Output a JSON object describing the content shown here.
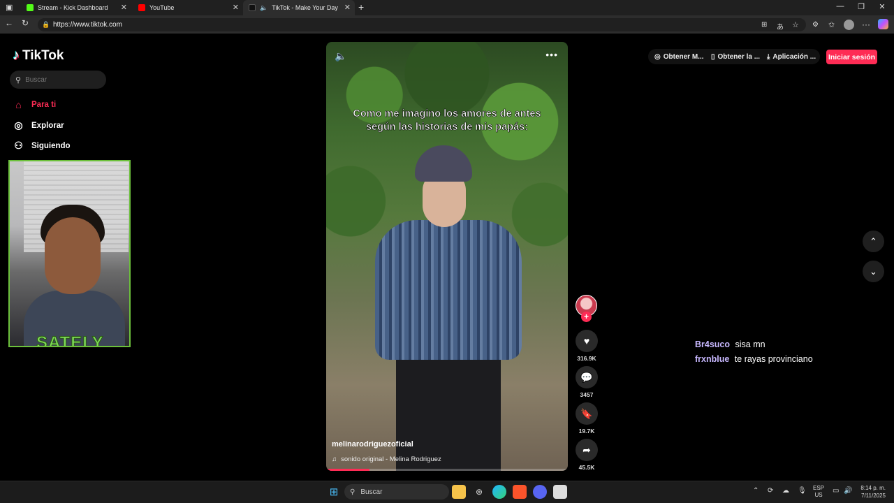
{
  "browser": {
    "tabs": [
      {
        "title": "Stream - Kick Dashboard",
        "favicon_color": "#53fc18"
      },
      {
        "title": "YouTube",
        "favicon_color": "#ff0000"
      },
      {
        "title": "TikTok - Make Your Day",
        "favicon_color": "#111111",
        "active": true
      }
    ],
    "url": "https://www.tiktok.com"
  },
  "tiktok": {
    "logo": "TikTok",
    "search_placeholder": "Buscar",
    "nav": {
      "for_you": "Para ti",
      "explore": "Explorar",
      "following": "Siguiendo"
    },
    "header": {
      "get_coins": "Obtener M...",
      "get_app": "Obtener la ...",
      "desktop_app": "Aplicación ...",
      "login": "Iniciar sesión"
    },
    "video": {
      "caption_line1": "Como me imagino los amores de antes",
      "caption_line2": "según las historias de mis papás:",
      "author": "melinarodriguezoficial",
      "sound": "sonido original - Melina Rodriguez",
      "progress": 0.18
    },
    "actions": {
      "likes": "316.9K",
      "comments": "3457",
      "saves": "19.7K",
      "shares": "45.5K"
    }
  },
  "webcam": {
    "brand": "SATELY"
  },
  "chat": [
    {
      "user": "Br4suco",
      "message": "sisa mn"
    },
    {
      "user": "frxnblue",
      "message": "te rayas provinciano"
    }
  ],
  "taskbar": {
    "search_label": "Buscar",
    "lang_top": "ESP",
    "lang_bottom": "US",
    "time": "8:14 p. m.",
    "date": "7/11/2025"
  },
  "colors": {
    "accent": "#fe2c55",
    "chat_user": "#c8b8ff",
    "webcam_border": "#6cc13b"
  }
}
